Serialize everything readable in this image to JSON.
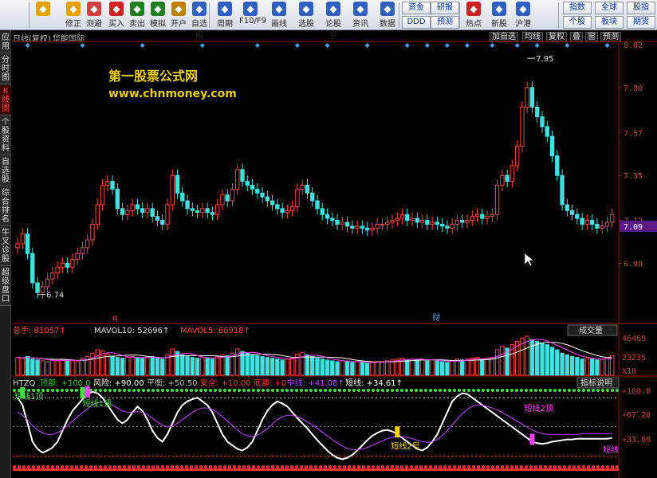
{
  "toolbar": {
    "buttons": [
      {
        "label": "",
        "icon": "back-arrow-icon",
        "color": "#e8a000"
      },
      {
        "label": "修正",
        "icon": "fix-icon",
        "color": "#e8a000"
      },
      {
        "label": "测避",
        "icon": "clock-icon",
        "color": "#d04040"
      },
      {
        "label": "买入",
        "icon": "buy-icon",
        "color": "#d02020"
      },
      {
        "label": "卖出",
        "icon": "sell-icon",
        "color": "#208020"
      },
      {
        "label": "模拟",
        "icon": "simulate-icon",
        "color": "#208020"
      },
      {
        "label": "开户",
        "icon": "lock-icon",
        "color": "#c08000"
      },
      {
        "label": "自选股",
        "icon": "watchlist-icon",
        "color": "#3060c0"
      },
      {
        "label": "周期",
        "icon": "period-icon",
        "color": "#3060c0"
      },
      {
        "label": "F10/F9",
        "icon": "f10-icon",
        "color": "#3060c0"
      },
      {
        "label": "画线",
        "icon": "draw-icon",
        "color": "#3060c0"
      },
      {
        "label": "选股",
        "icon": "select-icon",
        "color": "#3060c0"
      },
      {
        "label": "论股堂",
        "icon": "forum-icon",
        "color": "#3060c0"
      },
      {
        "label": "资讯",
        "icon": "news-icon",
        "color": "#3060c0"
      },
      {
        "label": "数据",
        "icon": "data-icon",
        "color": "#3060c0"
      },
      {
        "label": "热点",
        "icon": "hot-icon",
        "color": "#d02020"
      },
      {
        "label": "新股",
        "icon": "ipo-icon",
        "color": "#3060c0"
      },
      {
        "label": "沪港通",
        "icon": "hk-connect-icon",
        "color": "#3060c0"
      }
    ],
    "right_buttons": [
      "资金",
      "研报",
      "DDD",
      "预测",
      "指数",
      "全球",
      "股指",
      "个股",
      "板块",
      "期货"
    ]
  },
  "side_tabs": [
    "应用",
    "分时图",
    "K线图",
    "个股资料",
    "自选股",
    "综合排名",
    "牛叉诊股",
    "超级盘口"
  ],
  "chart_header": {
    "mode": "日线(复权)",
    "stock": "华能国际"
  },
  "chart_controls": [
    "加自选",
    "均线",
    "复权",
    "叠",
    "窗",
    "预测"
  ],
  "watermark": {
    "line1": "第一股票公式网",
    "line2": "www.chnmoney.com"
  },
  "price_axis": [
    "8.02",
    "7.80",
    "7.57",
    "7.35",
    "7.12",
    "6.90"
  ],
  "current_price": "7.09",
  "annotations": {
    "high": "7.95",
    "low": "6.74",
    "marker_q": "q",
    "marker_cai": "财"
  },
  "volume": {
    "label_total": "总手: 81057↑",
    "label_ma10": "MAVOL10: 52696↑",
    "label_ma5": "MAVOL5: 66918↑",
    "selector": "成交量",
    "axis": [
      "46469",
      "23235",
      "X10"
    ]
  },
  "indicator": {
    "name": "HTZQ",
    "items": [
      {
        "text": "顶部: +100.0",
        "color": "#40c040"
      },
      {
        "text": "风险: +90.00",
        "color": "#ffffff"
      },
      {
        "text": "平衡: +50.50",
        "color": "#c0c0c0"
      },
      {
        "text": "安全: +10.00",
        "color": "#ff3030"
      },
      {
        "text": "底部: +0",
        "color": "#ff3030"
      },
      {
        "text": "中线: +41.08↑",
        "color": "#c040ff"
      },
      {
        "text": "短线: +34.61↑",
        "color": "#ffffff"
      }
    ],
    "button": "指标说明",
    "axis": [
      "+100.0",
      "+67.20",
      "+33.60"
    ],
    "labels": [
      "短线1顶",
      "短线1顶",
      "短线2顶",
      "短线2号",
      "短线"
    ]
  },
  "chart_data": [
    {
      "type": "candlestick",
      "title": "华能国际",
      "ylim": [
        6.6,
        8.02
      ],
      "close": [
        7.0,
        7.05,
        6.95,
        6.8,
        6.75,
        6.78,
        6.82,
        6.85,
        6.88,
        6.9,
        6.88,
        6.92,
        6.95,
        6.98,
        7.02,
        7.1,
        7.2,
        7.3,
        7.32,
        7.28,
        7.18,
        7.15,
        7.17,
        7.2,
        7.18,
        7.16,
        7.18,
        7.14,
        7.12,
        7.1,
        7.2,
        7.35,
        7.26,
        7.22,
        7.18,
        7.17,
        7.16,
        7.18,
        7.16,
        7.15,
        7.2,
        7.25,
        7.22,
        7.28,
        7.38,
        7.32,
        7.3,
        7.28,
        7.26,
        7.24,
        7.22,
        7.2,
        7.18,
        7.16,
        7.17,
        7.19,
        7.28,
        7.3,
        7.26,
        7.22,
        7.18,
        7.15,
        7.13,
        7.12,
        7.1,
        7.11,
        7.09,
        7.08,
        7.09,
        7.08,
        7.07,
        7.08,
        7.1,
        7.1,
        7.11,
        7.12,
        7.13,
        7.15,
        7.12,
        7.13,
        7.11,
        7.12,
        7.1,
        7.11,
        7.1,
        7.09,
        7.08,
        7.1,
        7.12,
        7.11,
        7.12,
        7.14,
        7.15,
        7.13,
        7.14,
        7.15,
        7.3,
        7.35,
        7.32,
        7.4,
        7.5,
        7.7,
        7.8,
        7.7,
        7.65,
        7.6,
        7.55,
        7.45,
        7.35,
        7.2,
        7.17,
        7.15,
        7.13,
        7.1,
        7.12,
        7.1,
        7.08,
        7.09,
        7.11,
        7.15
      ]
    },
    {
      "type": "bar",
      "title": "成交量",
      "ylabel": "X10",
      "ylim": [
        0,
        46469
      ],
      "values": [
        21,
        20,
        22,
        19,
        18,
        17,
        16,
        18,
        17,
        19,
        18,
        17,
        16,
        20,
        22,
        26,
        30,
        29,
        25,
        22,
        21,
        20,
        21,
        22,
        21,
        20,
        21,
        22,
        20,
        19,
        24,
        31,
        28,
        24,
        22,
        21,
        20,
        21,
        20,
        19,
        22,
        24,
        23,
        26,
        31,
        28,
        26,
        24,
        23,
        22,
        21,
        20,
        19,
        18,
        19,
        20,
        25,
        27,
        24,
        22,
        20,
        19,
        18,
        17,
        16,
        17,
        16,
        15,
        16,
        15,
        14,
        15,
        16,
        16,
        17,
        18,
        19,
        20,
        18,
        19,
        18,
        19,
        17,
        18,
        17,
        16,
        15,
        17,
        19,
        18,
        19,
        20,
        21,
        19,
        20,
        21,
        30,
        34,
        32,
        36,
        40,
        44,
        46,
        42,
        40,
        38,
        36,
        33,
        30,
        26,
        24,
        22,
        21,
        19,
        20,
        19,
        18,
        19,
        21,
        23
      ]
    },
    {
      "type": "line",
      "title": "HTZQ",
      "ylim": [
        0,
        100
      ],
      "series": [
        {
          "name": "短线",
          "values": [
            90,
            80,
            55,
            30,
            20,
            15,
            18,
            22,
            30,
            45,
            60,
            72,
            80,
            88,
            95,
            98,
            96,
            90,
            80,
            70,
            60,
            55,
            60,
            70,
            78,
            72,
            60,
            45,
            35,
            30,
            40,
            55,
            70,
            80,
            85,
            88,
            90,
            85,
            80,
            70,
            55,
            40,
            30,
            25,
            20,
            18,
            22,
            30,
            45,
            60,
            72,
            80,
            85,
            82,
            78,
            70,
            62,
            55,
            48,
            40,
            32,
            25,
            18,
            12,
            8,
            6,
            8,
            12,
            18,
            25,
            32,
            38,
            42,
            45,
            46,
            44,
            40,
            35,
            30,
            25,
            20,
            18,
            22,
            30,
            40,
            55,
            70,
            85,
            92,
            96,
            95,
            90,
            85,
            80,
            75,
            70,
            65,
            60,
            55,
            50,
            45,
            40,
            35,
            30,
            28,
            27,
            28,
            30,
            31,
            32,
            33,
            33,
            34,
            34,
            34,
            34,
            34,
            34,
            34,
            35
          ]
        },
        {
          "name": "中线",
          "values": [
            70,
            66,
            60,
            52,
            46,
            42,
            40,
            40,
            42,
            46,
            52,
            58,
            64,
            70,
            75,
            80,
            83,
            84,
            83,
            80,
            76,
            72,
            70,
            70,
            71,
            70,
            67,
            62,
            57,
            52,
            50,
            51,
            55,
            60,
            65,
            70,
            74,
            76,
            76,
            74,
            70,
            64,
            58,
            52,
            46,
            41,
            38,
            37,
            39,
            43,
            48,
            54,
            60,
            64,
            66,
            66,
            64,
            61,
            57,
            53,
            48,
            43,
            38,
            33,
            28,
            24,
            21,
            19,
            19,
            20,
            22,
            25,
            28,
            31,
            34,
            36,
            37,
            37,
            36,
            34,
            32,
            30,
            29,
            30,
            33,
            38,
            45,
            53,
            61,
            68,
            74,
            78,
            80,
            80,
            78,
            76,
            73,
            70,
            66,
            62,
            58,
            54,
            50,
            46,
            43,
            41,
            40,
            40,
            40,
            40,
            40,
            40,
            40,
            41,
            41,
            41,
            41,
            41,
            41,
            41
          ]
        }
      ]
    }
  ]
}
